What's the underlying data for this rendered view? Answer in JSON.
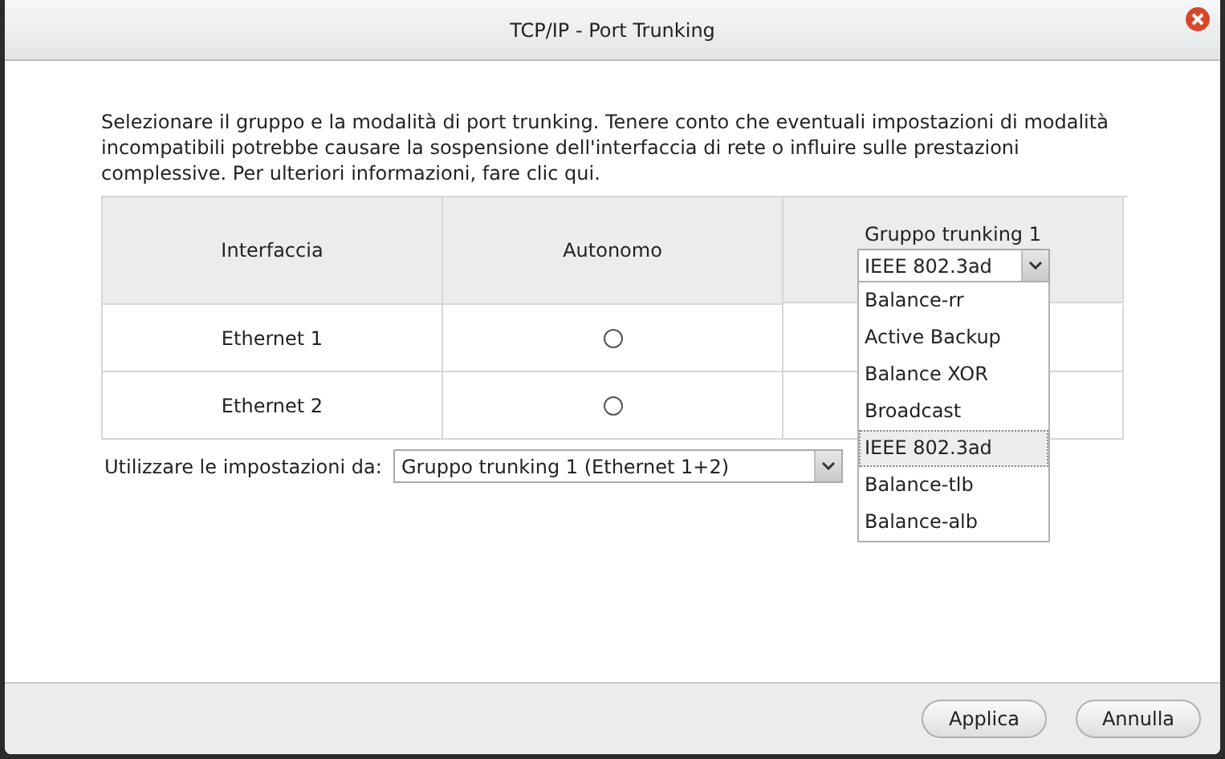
{
  "window": {
    "title": "TCP/IP - Port Trunking"
  },
  "description": "Selezionare il gruppo e la modalità di port trunking. Tenere conto che eventuali impostazioni di modalità incompatibili potrebbe causare la sospensione dell'interfaccia di rete o influire sulle prestazioni complessive. Per ulteriori informazioni, fare clic qui.",
  "table": {
    "columns": [
      "Interfaccia",
      "Autonomo",
      "Gruppo trunking 1"
    ],
    "group_select": {
      "value": "IEEE 802.3ad",
      "expanded": true,
      "options": [
        {
          "label": "Balance-rr",
          "selected": false
        },
        {
          "label": "Active Backup",
          "selected": false
        },
        {
          "label": "Balance XOR",
          "selected": false
        },
        {
          "label": "Broadcast",
          "selected": false
        },
        {
          "label": "IEEE 802.3ad",
          "selected": true
        },
        {
          "label": "Balance-tlb",
          "selected": false
        },
        {
          "label": "Balance-alb",
          "selected": false
        }
      ]
    },
    "rows": [
      {
        "interface": "Ethernet 1",
        "standalone_selected": false
      },
      {
        "interface": "Ethernet 2",
        "standalone_selected": false
      }
    ]
  },
  "settings_from": {
    "label": "Utilizzare le impostazioni da:",
    "value": "Gruppo trunking 1 (Ethernet 1+2)"
  },
  "buttons": [
    "Applica",
    "Annulla"
  ]
}
